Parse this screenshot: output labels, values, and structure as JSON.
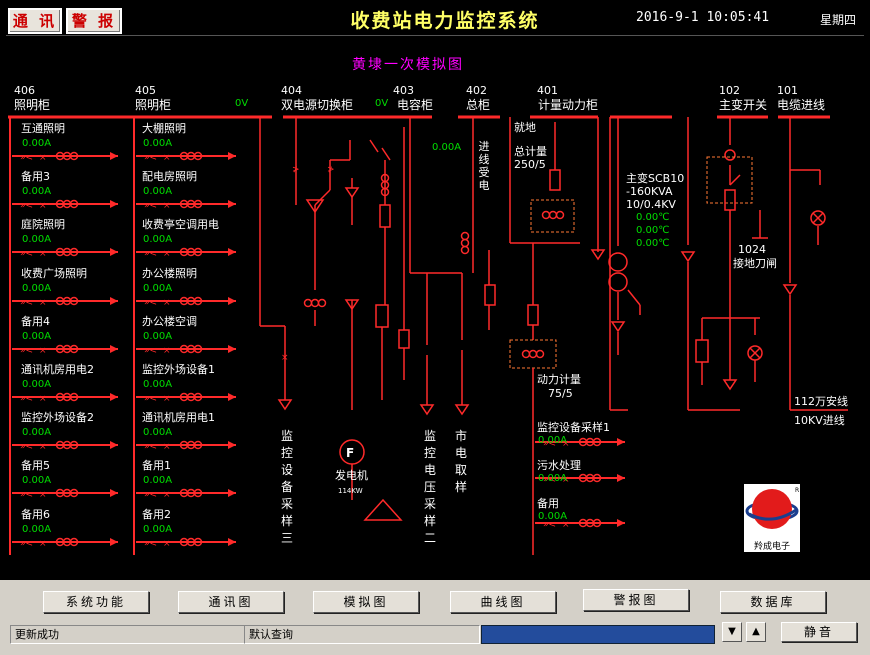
{
  "toolbar": {
    "comm_label": "通 讯",
    "alarm_label": "警 报"
  },
  "header": {
    "title": "收费站电力监控系统",
    "datetime": "2016-9-1 10:05:41",
    "weekday": "星期四"
  },
  "diagram": {
    "title": "黄埭一次模拟图",
    "panel_406": {
      "number": "406",
      "name": "照明柜"
    },
    "panel_405": {
      "number": "405",
      "name": "照明柜",
      "voltage": "0V"
    },
    "panel_404": {
      "number": "404",
      "name": "双电源切换柜",
      "voltage": "0V"
    },
    "panel_403": {
      "number": "403",
      "name": "电容柜"
    },
    "panel_402": {
      "number": "402",
      "name": "总柜",
      "current": "0.00A",
      "incoming": "进线受电"
    },
    "panel_401": {
      "number": "401",
      "name": "计量动力柜",
      "local": "就地",
      "meter_total": "总计量",
      "meter_total_ratio": "250/5",
      "meter_power": "动力计量",
      "meter_power_ratio": "75/5"
    },
    "panel_102": {
      "number": "102",
      "name": "主变开关",
      "grounding": "1024",
      "grounding_label": "接地刀闸"
    },
    "panel_101": {
      "number": "101",
      "name": "电缆进线",
      "line_name": "112万安线",
      "line_desc": "10KV进线"
    },
    "transformer": {
      "name": "主变SCB10",
      "capacity": "-160KVA",
      "ratio": "10/0.4KV",
      "temps": [
        "0.00℃",
        "0.00℃",
        "0.00℃"
      ]
    },
    "generator": {
      "symbol": "F",
      "name": "发电机",
      "rating": "114KW"
    },
    "left_loads": [
      {
        "name": "互通照明",
        "current": "0.00A"
      },
      {
        "name": "备用3",
        "current": "0.00A"
      },
      {
        "name": "庭院照明",
        "current": "0.00A"
      },
      {
        "name": "收费广场照明",
        "current": "0.00A"
      },
      {
        "name": "备用4",
        "current": "0.00A"
      },
      {
        "name": "通讯机房用电2",
        "current": "0.00A"
      },
      {
        "name": "监控外场设备2",
        "current": "0.00A"
      },
      {
        "name": "备用5",
        "current": "0.00A"
      },
      {
        "name": "备用6",
        "current": "0.00A"
      }
    ],
    "mid_loads": [
      {
        "name": "大棚照明",
        "current": "0.00A"
      },
      {
        "name": "配电房照明",
        "current": "0.00A"
      },
      {
        "name": "收费亭空调用电",
        "current": "0.00A"
      },
      {
        "name": "办公楼照明",
        "current": "0.00A"
      },
      {
        "name": "办公楼空调",
        "current": "0.00A"
      },
      {
        "name": "监控外场设备1",
        "current": "0.00A"
      },
      {
        "name": "通讯机房用电1",
        "current": "0.00A"
      },
      {
        "name": "备用1",
        "current": "0.00A"
      },
      {
        "name": "备用2",
        "current": "0.00A"
      }
    ],
    "right_loads": [
      {
        "name": "监控设备采样1",
        "current": "0.00A"
      },
      {
        "name": "污水处理",
        "current": "0.00A"
      },
      {
        "name": "备用",
        "current": "0.00A"
      }
    ],
    "vlabels": {
      "sample3": "监控设备采样三",
      "sample2": "监控电压采样二",
      "city": "市电取样"
    },
    "logo": {
      "text": "羚成电子"
    }
  },
  "functions": [
    "系统功能",
    "通讯图",
    "模拟图",
    "曲线图",
    "警报图",
    "数据库"
  ],
  "status": {
    "message": "更新成功",
    "query": "默认查询",
    "mute": "静音",
    "down_arrow": "▼",
    "up_arrow": "▲"
  }
}
